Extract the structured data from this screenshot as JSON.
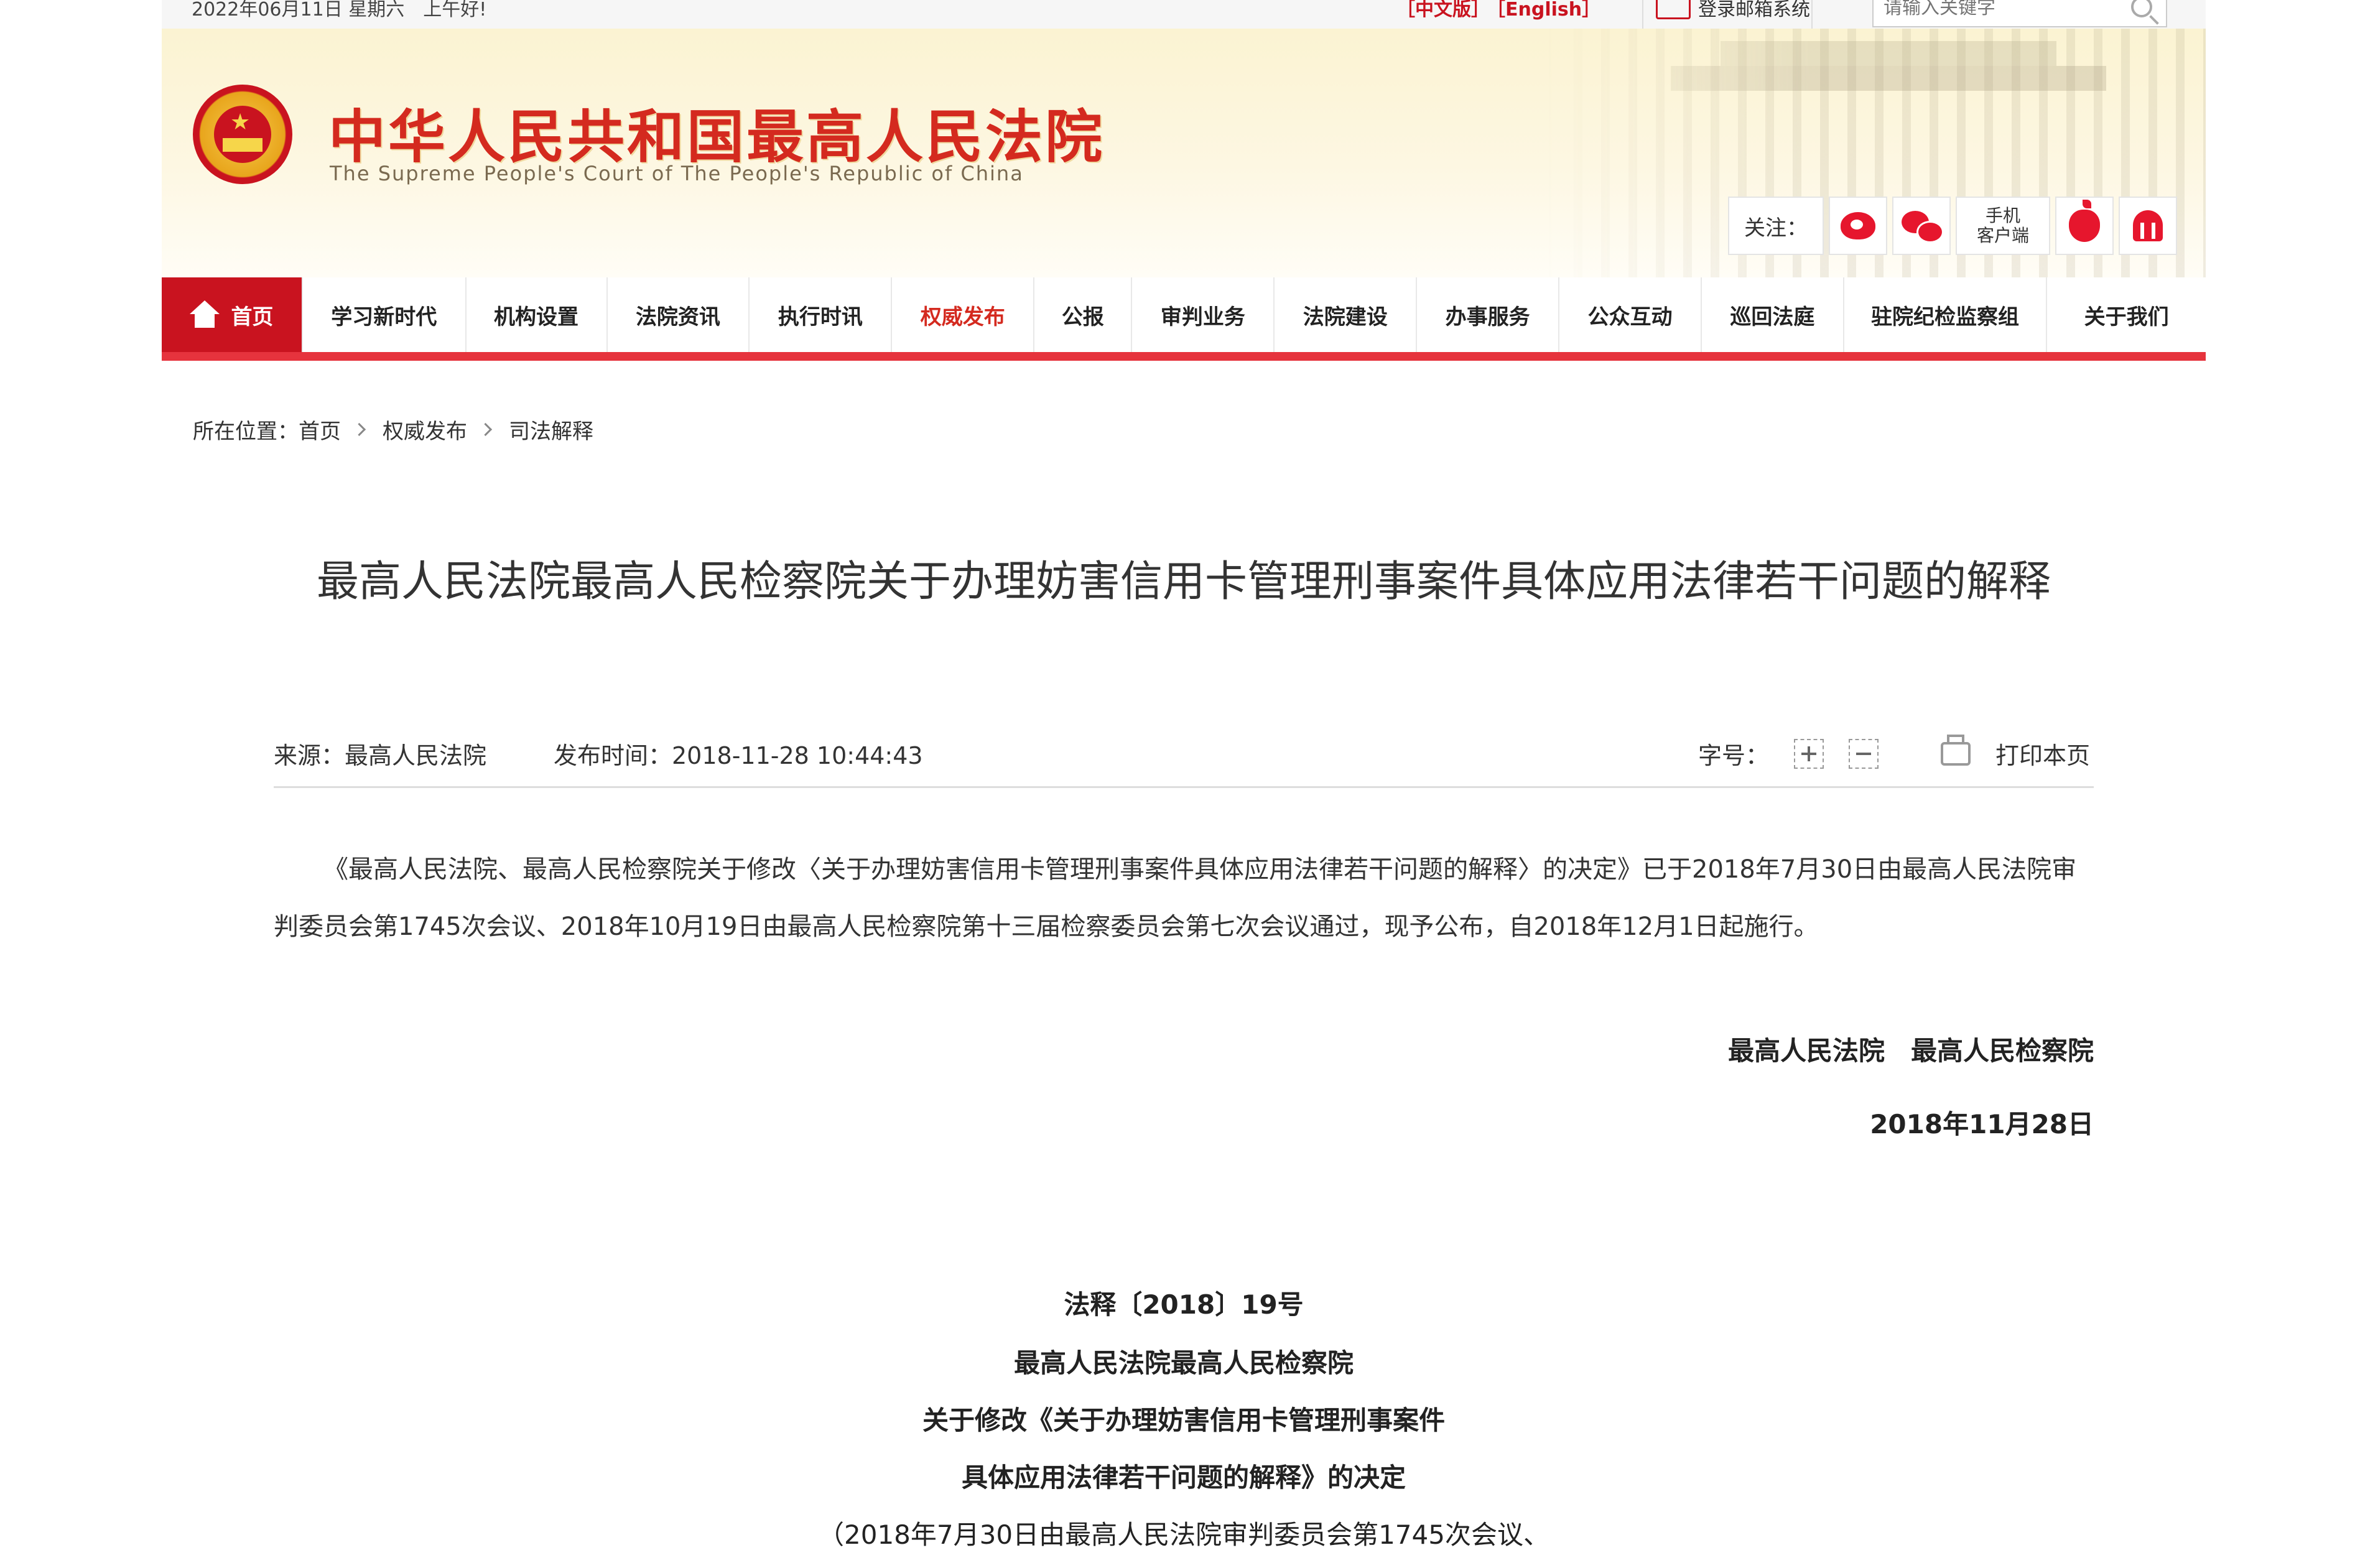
{
  "topbar": {
    "date": "2022年06月11日 星期六　上午好!",
    "lang_cn": "［中文版］",
    "lang_en": "［English］",
    "mail": "登录邮箱系统",
    "search_placeholder": "请输入关键字"
  },
  "header": {
    "title": "中华人民共和国最高人民法院",
    "subtitle": "The Supreme People's Court of The People's Republic of China",
    "follow_label": "关注：",
    "mobile_line1": "手机",
    "mobile_line2": "客户端"
  },
  "nav": {
    "items": [
      "首页",
      "学习新时代",
      "机构设置",
      "法院资讯",
      "执行时讯",
      "权威发布",
      "公报",
      "审判业务",
      "法院建设",
      "办事服务",
      "公众互动",
      "巡回法庭",
      "驻院纪检监察组",
      "关于我们"
    ],
    "active": "首页",
    "highlight": "权威发布"
  },
  "breadcrumb": {
    "label": "所在位置：",
    "items": [
      "首页",
      "权威发布",
      "司法解释"
    ]
  },
  "article": {
    "title": "最高人民法院最高人民检察院关于办理妨害信用卡管理刑事案件具体应用法律若干问题的解释",
    "source": "来源：最高人民法院",
    "publish_time": "发布时间：2018-11-28 10:44:43",
    "font_label": "字号：",
    "print_label": "打印本页",
    "paragraph": "《最高人民法院、最高人民检察院关于修改〈关于办理妨害信用卡管理刑事案件具体应用法律若干问题的解释〉的决定》已于2018年7月30日由最高人民法院审判委员会第1745次会议、2018年10月19日由最高人民检察院第十三届检察委员会第七次会议通过，现予公布，自2018年12月1日起施行。",
    "signature": "最高人民法院　最高人民检察院",
    "sign_date": "2018年11月28日",
    "doc_no": "法释〔2018〕19号",
    "doc_line1": "最高人民法院最高人民检察院",
    "doc_line2": "关于修改《关于办理妨害信用卡管理刑事案件",
    "doc_line3": "具体应用法律若干问题的解释》的决定",
    "doc_line4": "（2018年7月30日由最高人民法院审判委员会第1745次会议、"
  }
}
